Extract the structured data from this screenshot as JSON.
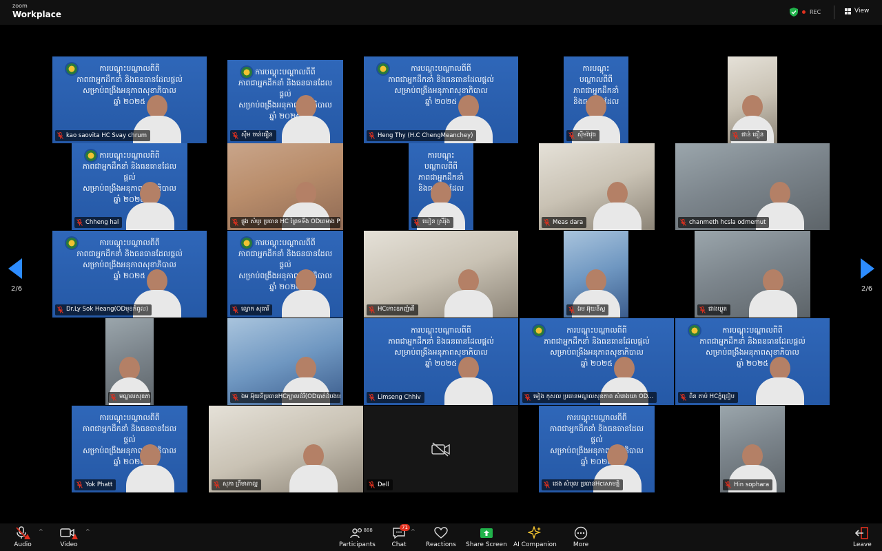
{
  "app": {
    "brand_small": "zoom",
    "brand_big": "Workplace"
  },
  "header": {
    "rec_label": "REC",
    "view_label": "View"
  },
  "pagination": {
    "left": "2/6",
    "right": "2/6"
  },
  "slide_text": {
    "line1": "ការបណ្ដុះបណ្ដាលពីពី",
    "line2": "ភាពជាអ្នកដឹកនាំ និងធនធានដែលផ្ដល់",
    "line3": "សម្រាប់ពង្រឹងអនុភាពសុខាភិបាល",
    "line4": "ឆ្នាំ ២០២៥"
  },
  "participants": [
    {
      "name": "kao saovita HC Svay chrum"
    },
    {
      "name": "ស៊ឹម ចាន់ធឿន"
    },
    {
      "name": "Heng Thy (H.C ChengMeanchey)"
    },
    {
      "name": "ស៊ីមរ៉ាវុធ"
    },
    {
      "name": "ផាន់ ធឿន"
    },
    {
      "name": "Chheng hal"
    },
    {
      "name": "ផ្លុង សំបូរ ប្រធាន HC ព្រៃទទឹង OD​ពេមាង PHD..."
    },
    {
      "name": "ឃៀន ស្រីរ៉ុង"
    },
    {
      "name": "Meas dara"
    },
    {
      "name": "chanmeth hcsla odmemut"
    },
    {
      "name": "Dr.Ly Sok Heang(ODមុខកំពូល)"
    },
    {
      "name": "ល្វោក សុធារី"
    },
    {
      "name": "HCកោះឧកញ៉ាតី"
    },
    {
      "name": "ឯម អ៊ុយនីស្ល"
    },
    {
      "name": "ជាងឃ្លួត"
    },
    {
      "name": "មណ្ឌលសុខភាព ក្បែរស្ពង"
    },
    {
      "name": "ឯម អ៊ុយនីប្រធានHCក្បាលដំរី(ODបាត់ដំបងខេត្តបាត់ដំបង)"
    },
    {
      "name": "Limseng Chhiv"
    },
    {
      "name": "មៀង កុសល ប្រធានមណ្ឌលសុខភាព សំរោងយា OD..."
    },
    {
      "name": "ពិន​ តាប៉ HCភ្នំជ្រៀប"
    },
    {
      "name": "Yok Phatt"
    },
    {
      "name": "សុភា ព្រឹមាតាល្អ"
    },
    {
      "name": "Dell"
    },
    {
      "name": "ផេង សំបុល ប្រធានHcសោមត្តិ"
    },
    {
      "name": "Hin sophara"
    }
  ],
  "toolbar": {
    "audio": "Audio",
    "video": "Video",
    "participants": "Participants",
    "participants_count": "888",
    "chat": "Chat",
    "chat_badge": "71",
    "reactions": "Reactions",
    "share_screen": "Share Screen",
    "ai_companion": "AI Companion",
    "more": "More",
    "leave": "Leave"
  },
  "colors": {
    "accent_green": "#21b24b",
    "mute_red": "#e0301e",
    "arrow_blue": "#2d8cff"
  }
}
